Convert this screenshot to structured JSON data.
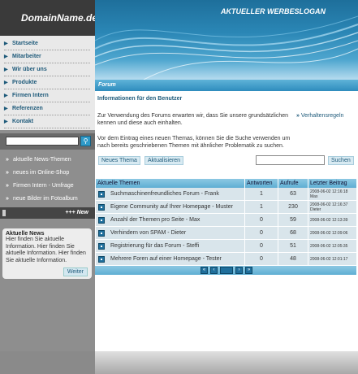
{
  "site": {
    "logo": "DomainName.de",
    "slogan": "AKTUELLER WERBESLOGAN"
  },
  "nav": [
    {
      "label": "Startseite"
    },
    {
      "label": "Mitarbeiter"
    },
    {
      "label": "Wir über uns"
    },
    {
      "label": "Produkte"
    },
    {
      "label": "Firmen Intern"
    },
    {
      "label": "Referenzen"
    },
    {
      "label": "Kontakt"
    }
  ],
  "sidebar_search": {
    "value": "",
    "icon": "search-icon"
  },
  "links": [
    {
      "label": "aktuelle News-Themen"
    },
    {
      "label": "neues im Online-Shop"
    },
    {
      "label": "Firmen Intern - Umfrage"
    },
    {
      "label": "neue Bilder im Fotoalbum"
    }
  ],
  "newbar": {
    "label": "+++ New"
  },
  "news": {
    "title": "Aktuelle News",
    "text": "Hier finden Sie aktuelle Information. Hier finden Sie aktuelle Information. Hier finden Sie aktuelle Information.",
    "button": "Weiter"
  },
  "forum": {
    "header": "Forum",
    "info_title": "Informationen für den Benutzer",
    "info_text": "Zur Verwendung des Forums erwarten wir, dass Sie unsere grundsätzlichen kennen und diese auch einhalten.",
    "info_text2": "Vor dem Eintrag eines neuen Themas, können Sie die Suche verwenden um nach bereits geschriebenen Themen mit ähnlicher Problematik zu suchen.",
    "rules_link": "Verhaltensregeln",
    "btn_new": "Neues Thema",
    "btn_update": "Aktualisieren",
    "search_value": "",
    "btn_search": "Suchen",
    "columns": [
      "Aktuelle Themen",
      "Antworten",
      "Aufrufe",
      "Letzter Beitrag"
    ],
    "rows": [
      {
        "title": "Suchmaschinenfreundliches Forum - Frank",
        "answers": "1",
        "views": "63",
        "date": "2008-06-02 12:16:18",
        "user": "Max"
      },
      {
        "title": "Eigene Community auf Ihrer Homepage - Muster",
        "answers": "1",
        "views": "230",
        "date": "2008-06-02 12:16:37",
        "user": "Dieter"
      },
      {
        "title": "Anzahl der Themen pro Seite - Max",
        "answers": "0",
        "views": "59",
        "date": "2008-06-02 12:13:39",
        "user": ""
      },
      {
        "title": "Verhindern von SPAM - Dieter",
        "answers": "0",
        "views": "68",
        "date": "2008-06-02 12:09:06",
        "user": ""
      },
      {
        "title": "Registrierung für das Forum - Steffi",
        "answers": "0",
        "views": "51",
        "date": "2008-06-02 12:05:35",
        "user": ""
      },
      {
        "title": "Mehrere Foren auf einer Homepage - Tester",
        "answers": "0",
        "views": "48",
        "date": "2008-06-02 12:01:17",
        "user": ""
      }
    ],
    "pager": {
      "first": "«",
      "prev": "‹",
      "page": "",
      "next": "›",
      "last": "»"
    }
  }
}
